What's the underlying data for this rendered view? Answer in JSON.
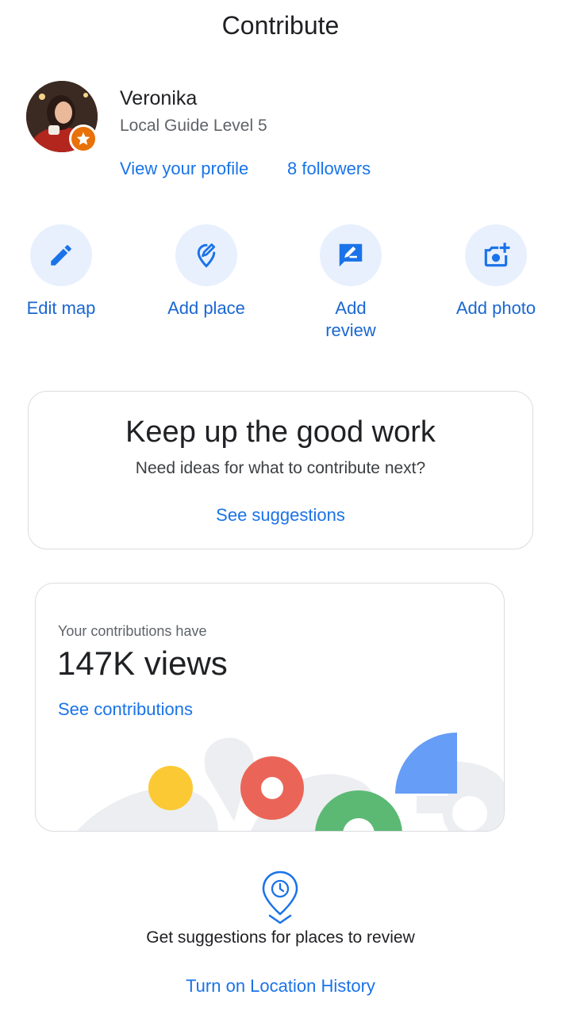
{
  "header": {
    "title": "Contribute"
  },
  "profile": {
    "name": "Veronika",
    "level": "Local Guide Level 5",
    "view_profile": "View your profile",
    "followers": "8 followers"
  },
  "actions": [
    {
      "label": "Edit map",
      "icon": "pencil-icon"
    },
    {
      "label": "Add place",
      "icon": "add-place-pin-icon"
    },
    {
      "label": "Add\nreview",
      "icon": "review-icon"
    },
    {
      "label": "Add photo",
      "icon": "add-photo-icon"
    }
  ],
  "keep_card": {
    "title": "Keep up the good work",
    "subtitle": "Need ideas for what to contribute next?",
    "link": "See suggestions"
  },
  "contributions": {
    "label": "Your contributions have",
    "views": "147K views",
    "link": "See contributions"
  },
  "location": {
    "text": "Get suggestions for places to review",
    "link": "Turn on Location History"
  },
  "colors": {
    "accent": "#1a73e8",
    "yellow": "#fbc934",
    "red": "#ea6558",
    "green": "#5bb974",
    "blue": "#669df6"
  }
}
